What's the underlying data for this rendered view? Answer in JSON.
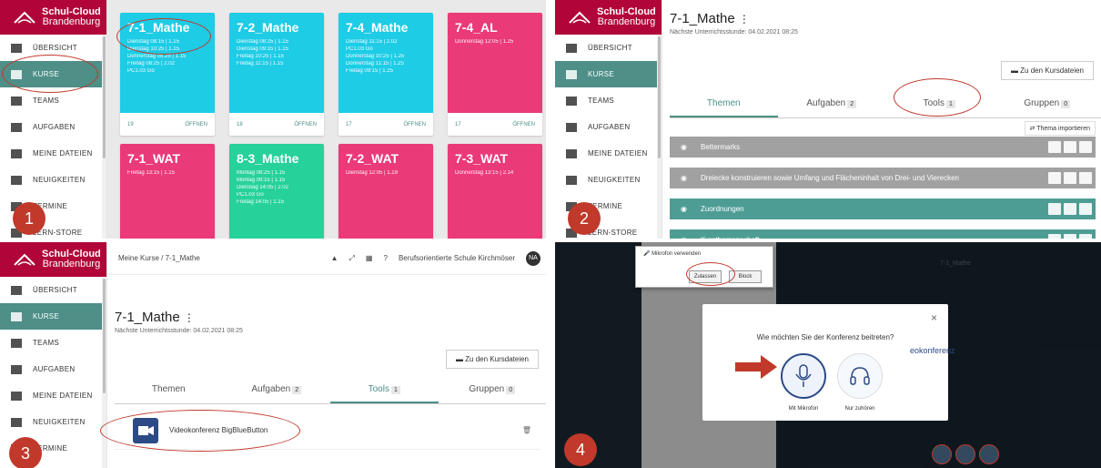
{
  "colors": {
    "brand": "#b10438",
    "accent": "#4e8f88",
    "cyan": "#1ecce6",
    "pink": "#ea3a78",
    "green": "#27d29a",
    "annotation": "#c0392b"
  },
  "logo": {
    "line1": "Schul-Cloud",
    "line2": "Brandenburg"
  },
  "nav": [
    {
      "label": "ÜBERSICHT",
      "icon": "grid-icon"
    },
    {
      "label": "KURSE",
      "icon": "graduation-cap-icon"
    },
    {
      "label": "TEAMS",
      "icon": "users-icon"
    },
    {
      "label": "AUFGABEN",
      "icon": "tasks-icon"
    },
    {
      "label": "MEINE DATEIEN",
      "icon": "folder-icon"
    },
    {
      "label": "NEUIGKEITEN",
      "icon": "newspaper-icon"
    },
    {
      "label": "TERMINE",
      "icon": "calendar-icon"
    },
    {
      "label": "LERN-STORE",
      "icon": "store-icon"
    }
  ],
  "panel1": {
    "badge": "1",
    "cards": [
      {
        "title": "7-1_Mathe",
        "color": "cyan",
        "times": [
          "Dienstag 08:15 | 1.15",
          "Dienstag 10:25 | 1.15",
          "Donnerstag 08:25 | 1.15",
          "Freitag 08:25 | 2.02",
          "PC1.03 Go"
        ],
        "count": "19",
        "open": "ÖFFNEN"
      },
      {
        "title": "7-2_Mathe",
        "color": "cyan",
        "times": [
          "Dienstag 08:25 | 1.15",
          "Dienstag 09:15 | 1.15",
          "Freitag 10:25 | 1.15",
          "Freitag 11:15 | 1.15"
        ],
        "count": "18",
        "open": "ÖFFNEN"
      },
      {
        "title": "7-4_Mathe",
        "color": "cyan",
        "times": [
          "Dienstag 11:15 | 2.02",
          "PC1.03 Go",
          "Donnerstag 10:25 | 1.25",
          "Donnerstag 11:15 | 1.25",
          "Freitag 09:15 | 1.25"
        ],
        "count": "17",
        "open": "ÖFFNEN"
      },
      {
        "title": "7-4_AL",
        "color": "pink",
        "times": [
          "Donnerstag 12:05 | 1.25"
        ],
        "count": "17",
        "open": "ÖFFNEN"
      },
      {
        "title": "7-1_WAT",
        "color": "pink",
        "times": [
          "Freitag 13:15 | 1.15"
        ],
        "count": "",
        "open": ""
      },
      {
        "title": "8-3_Mathe",
        "color": "green",
        "times": [
          "Montag 08:25 | 1.15",
          "Montag 09:15 | 1.15",
          "Dienstag 14:05 | 2.02",
          "PC1.03 Go",
          "Freitag 14:05 | 1.15"
        ],
        "count": "",
        "open": ""
      },
      {
        "title": "7-2_WAT",
        "color": "pink",
        "times": [
          "Dienstag 12:05 | 1.19"
        ],
        "count": "",
        "open": ""
      },
      {
        "title": "7-3_WAT",
        "color": "pink",
        "times": [
          "Donnerstag 13:15 | 2.14"
        ],
        "count": "",
        "open": ""
      }
    ]
  },
  "panel2": {
    "badge": "2",
    "title": "7-1_Mathe",
    "kebab": "⋮",
    "next_lesson": "Nächste Unterrichtsstunde: 04.02.2021 08:25",
    "files_button": "Zu den Kursdateien",
    "tabs": [
      {
        "label": "Themen",
        "count": ""
      },
      {
        "label": "Aufgaben",
        "count": "2"
      },
      {
        "label": "Tools",
        "count": "1"
      },
      {
        "label": "Gruppen",
        "count": "0"
      }
    ],
    "import_button": "⇄ Thema importieren",
    "topics": [
      {
        "label": "Bettermarks",
        "style": "grey"
      },
      {
        "label": "Dreiecke konstruieren sowie Umfang und Flächeninhalt von Drei- und Vierecken",
        "style": "grey"
      },
      {
        "label": "Zuordnungen",
        "style": "teal"
      },
      {
        "label": "Kursthemenschaft",
        "style": "teal"
      }
    ]
  },
  "panel3": {
    "badge": "3",
    "breadcrumb": "Meine Kurse / 7-1_Mathe",
    "school": "Berufsorientierte Schule Kirchmöser",
    "avatar": "NA",
    "title": "7-1_Mathe",
    "kebab": "⋮",
    "next_lesson": "Nächste Unterrichtsstunde: 04.02.2021 08:25",
    "files_button": "Zu den Kursdateien",
    "tabs": [
      {
        "label": "Themen",
        "count": ""
      },
      {
        "label": "Aufgaben",
        "count": "2"
      },
      {
        "label": "Tools",
        "count": "1"
      },
      {
        "label": "Gruppen",
        "count": "0"
      }
    ],
    "tool": "Videokonferenz BigBlueButton"
  },
  "panel4": {
    "badge": "4",
    "permission_text": "Mikrofon verwenden",
    "allow": "Zulassen",
    "block": "Block",
    "question": "Wie möchten Sie der Konferenz beitreten?",
    "opt_mic": "Mit Mikrofon",
    "opt_listen": "Nur zuhören",
    "room_title": "7-1_Mathe",
    "bg_heading": "eokonferenz"
  }
}
